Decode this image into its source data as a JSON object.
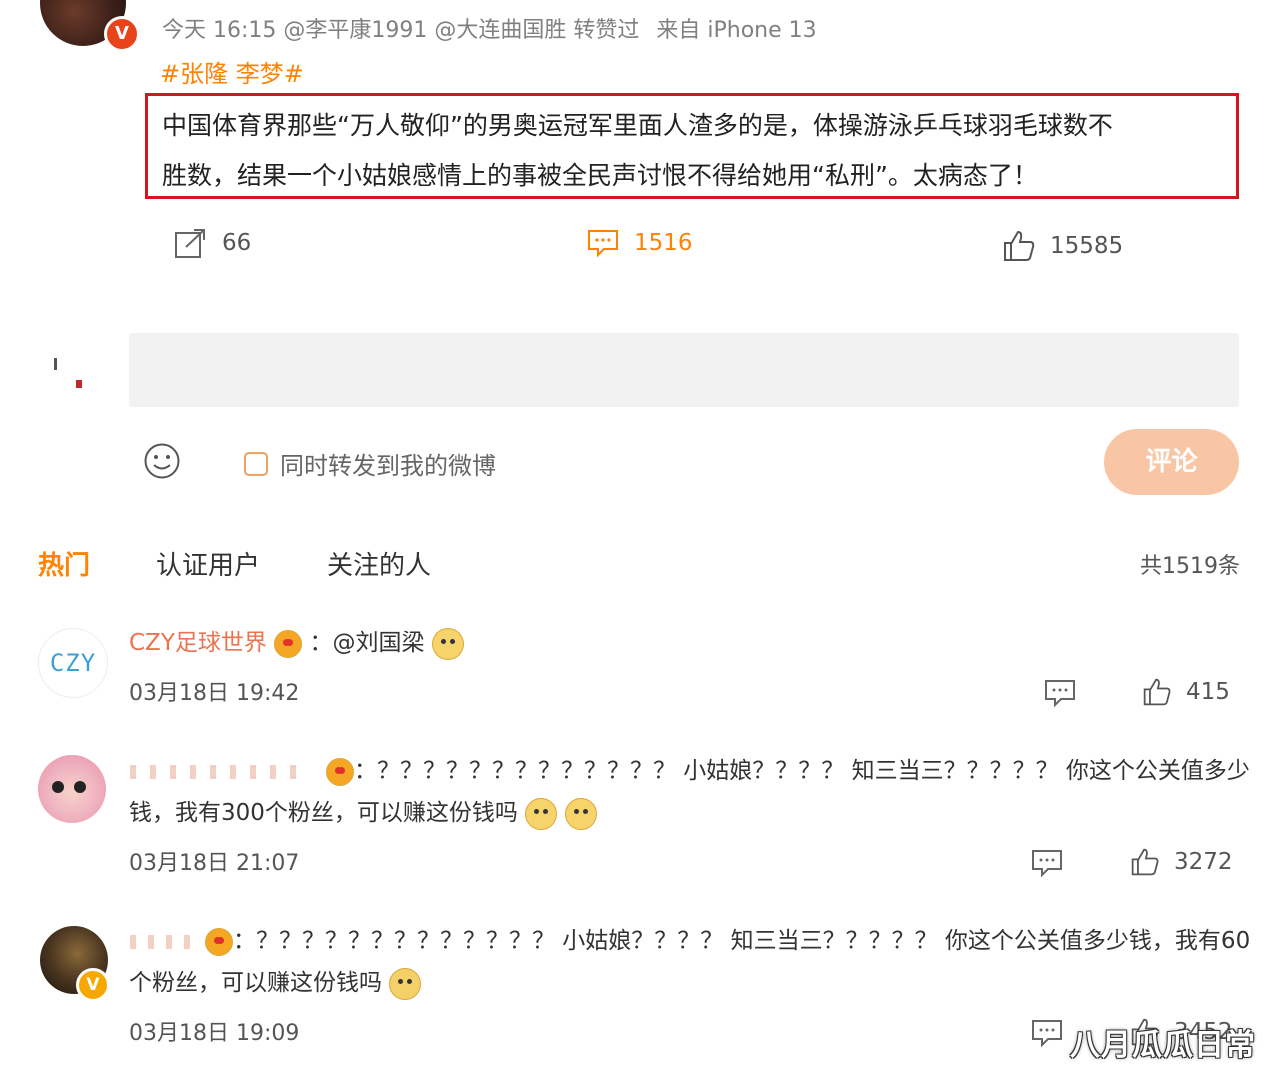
{
  "post": {
    "meta": "今天 16:15 @李平康1991 @大连曲国胜 转赞过",
    "source": "来自 iPhone 13",
    "hashtag": "#张隆 李梦#",
    "line1": "中国体育界那些“万人敬仰”的男奥运冠军里面人渣多的是，体操游泳乒乓球羽毛球数不",
    "line2": "胜数，结果一个小姑娘感情上的事被全民声讨恨不得给她用“私刑”。太病态了！",
    "badge_letter": "V"
  },
  "actions": {
    "repost_count": "66",
    "comment_count": "1516",
    "like_count": "15585"
  },
  "composer": {
    "checkbox_label": "同时转发到我的微博",
    "submit_label": "评论"
  },
  "tabs": {
    "hot": "热门",
    "verified": "认证用户",
    "following": "关注的人",
    "total": "共1519条"
  },
  "comments": [
    {
      "avatar_text": "CZY",
      "user": "CZY足球世界",
      "text": "：@刘国梁",
      "time": "03月18日 19:42",
      "likes": "415"
    },
    {
      "user": "",
      "text1": "：？？？？？？？？？？？？？ 小姑娘？？？？ 知三当三？？？？？ 你这个公关值多少",
      "text2": "钱，我有300个粉丝，可以赚这份钱吗",
      "time": "03月18日 21:07",
      "likes": "3272"
    },
    {
      "user": "",
      "text1": "：？？？？？？？？？？？？？ 小姑娘？？？？ 知三当三？？？？？ 你这个公关值多少钱，我有60",
      "text2": "个粉丝，可以赚这份钱吗",
      "time": "03月18日 19:09",
      "likes": "3452",
      "badge_letter": "V"
    }
  ],
  "watermark": "八月瓜瓜日常",
  "colors": {
    "accent": "#ff8200",
    "highlight_border": "#d8141f",
    "submit_bg": "#f9c6a5"
  }
}
